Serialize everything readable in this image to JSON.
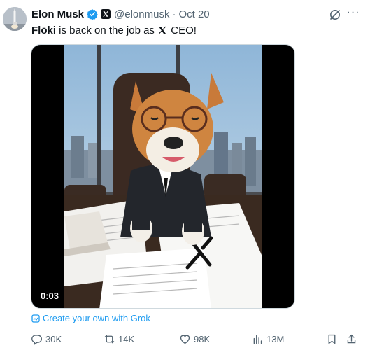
{
  "author": {
    "display_name": "Elon Musk",
    "handle": "@elonmusk",
    "separator": "·",
    "date": "Oct 20",
    "verified_icon": "verified-badge-icon",
    "affiliation_icon": "x-logo-icon"
  },
  "post": {
    "text_bold": "Flōki",
    "text_before_logo": " is back on the job as ",
    "text_after_logo": " CEO!"
  },
  "media": {
    "type": "video",
    "duration": "0:03"
  },
  "grok": {
    "create_label": "Create your own with Grok"
  },
  "more_label": "···",
  "actions": {
    "replies": "30K",
    "reposts": "14K",
    "likes": "98K",
    "views": "13M"
  },
  "colors": {
    "accent": "#1d9bf0",
    "muted": "#536471",
    "text": "#0f1419"
  }
}
